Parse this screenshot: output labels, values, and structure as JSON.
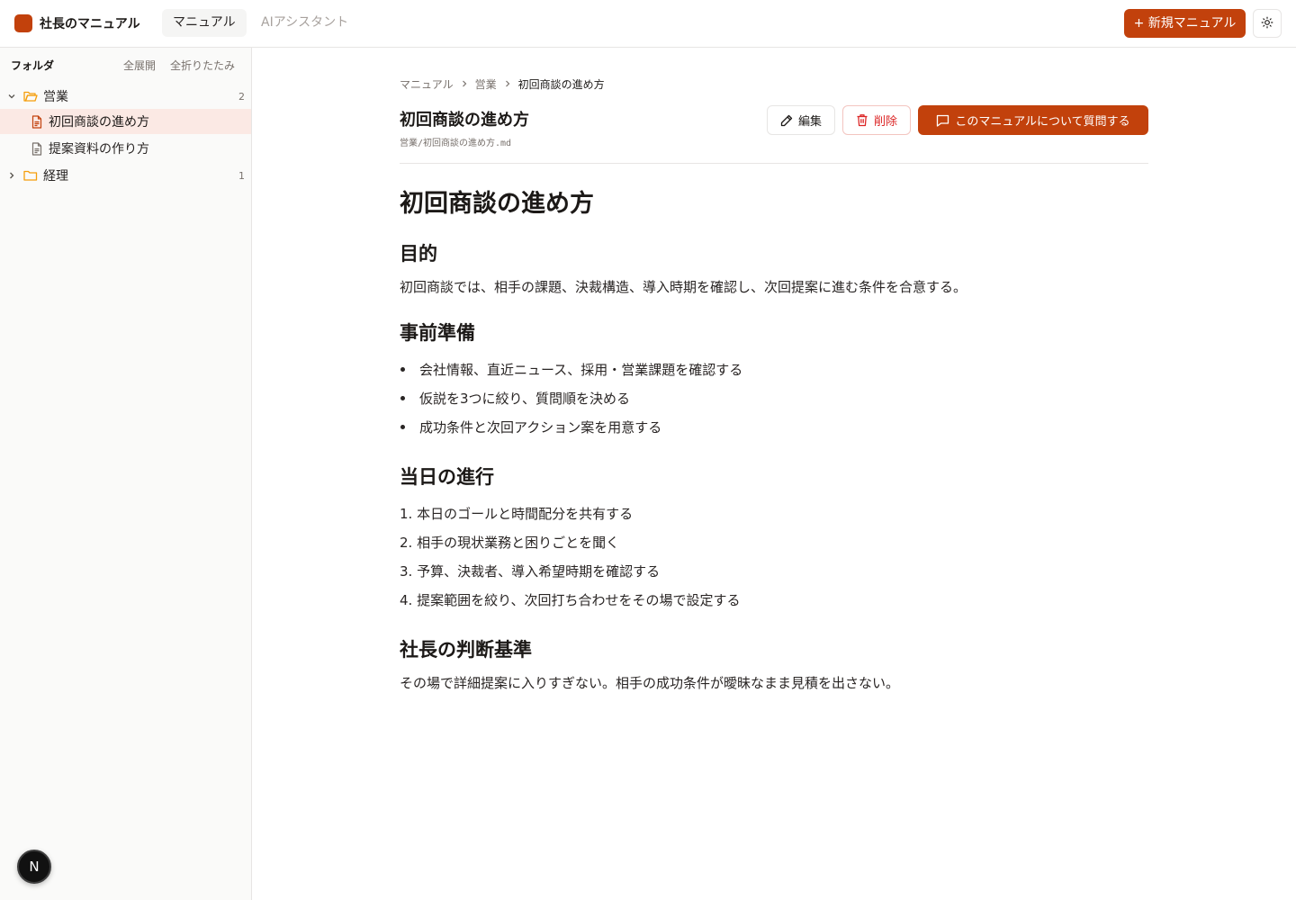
{
  "header": {
    "app_name": "社長のマニュアル",
    "tabs": [
      {
        "label": "マニュアル",
        "active": true
      },
      {
        "label": "AIアシスタント",
        "active": false
      }
    ],
    "new_button": "+ 新規マニュアル",
    "theme_icon": "sun-icon",
    "accent": "#c2410c"
  },
  "sidebar": {
    "title": "フォルダ",
    "expand_all": "全展開",
    "collapse_all": "全折りたたみ",
    "folders": [
      {
        "name": "営業",
        "count": "2",
        "expanded": true,
        "files": [
          {
            "name": "初回商談の進め方",
            "selected": true
          },
          {
            "name": "提案資料の作り方",
            "selected": false
          }
        ]
      },
      {
        "name": "経理",
        "count": "1",
        "expanded": false,
        "files": []
      }
    ]
  },
  "breadcrumb": [
    "マニュアル",
    "営業",
    "初回商談の進め方"
  ],
  "document": {
    "title": "初回商談の進め方",
    "path": "営業/初回商談の進め方.md",
    "actions": {
      "edit": "編集",
      "delete": "削除",
      "ask": "このマニュアルについて質問する"
    },
    "body": {
      "h1": "初回商談の進め方",
      "sections": [
        {
          "heading": "目的",
          "paragraph": "初回商談では、相手の課題、決裁構造、導入時期を確認し、次回提案に進む条件を合意する。"
        },
        {
          "heading": "事前準備",
          "bullets": [
            "会社情報、直近ニュース、採用・営業課題を確認する",
            "仮説を3つに絞り、質問順を決める",
            "成功条件と次回アクション案を用意する"
          ]
        },
        {
          "heading": "当日の進行",
          "ordered": [
            "1. 本日のゴールと時間配分を共有する",
            "2. 相手の現状業務と困りごとを聞く",
            "3. 予算、決裁者、導入希望時期を確認する",
            "4. 提案範囲を絞り、次回打ち合わせをその場で設定する"
          ]
        },
        {
          "heading": "社長の判断基準",
          "paragraph": "その場で詳細提案に入りすぎない。相手の成功条件が曖昧なまま見積を出さない。"
        }
      ]
    }
  },
  "dev_badge": "N"
}
